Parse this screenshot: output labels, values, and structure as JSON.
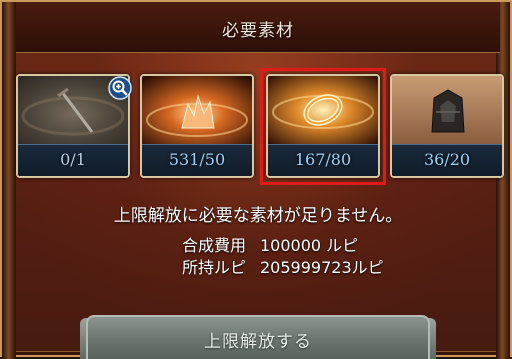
{
  "dialog": {
    "title": "必要素材"
  },
  "materials": [
    {
      "icon": "sword-item-icon",
      "count": "0/1"
    },
    {
      "icon": "orange-crystal-item-icon",
      "count": "531/50"
    },
    {
      "icon": "golden-ring-item-icon",
      "count": "167/80"
    },
    {
      "icon": "dark-ore-item-icon",
      "count": "36/20"
    }
  ],
  "message": "上限解放に必要な素材が足りません。",
  "cost": {
    "label": "合成費用",
    "value": "100000 ルピ"
  },
  "owned": {
    "label": "所持ルピ",
    "value": "205999723ルピ"
  },
  "button": {
    "label": "上限解放する"
  },
  "colors": {
    "highlight": "#e01a1a",
    "count_text": "#9fd0f2",
    "panel": "#5a2013"
  }
}
